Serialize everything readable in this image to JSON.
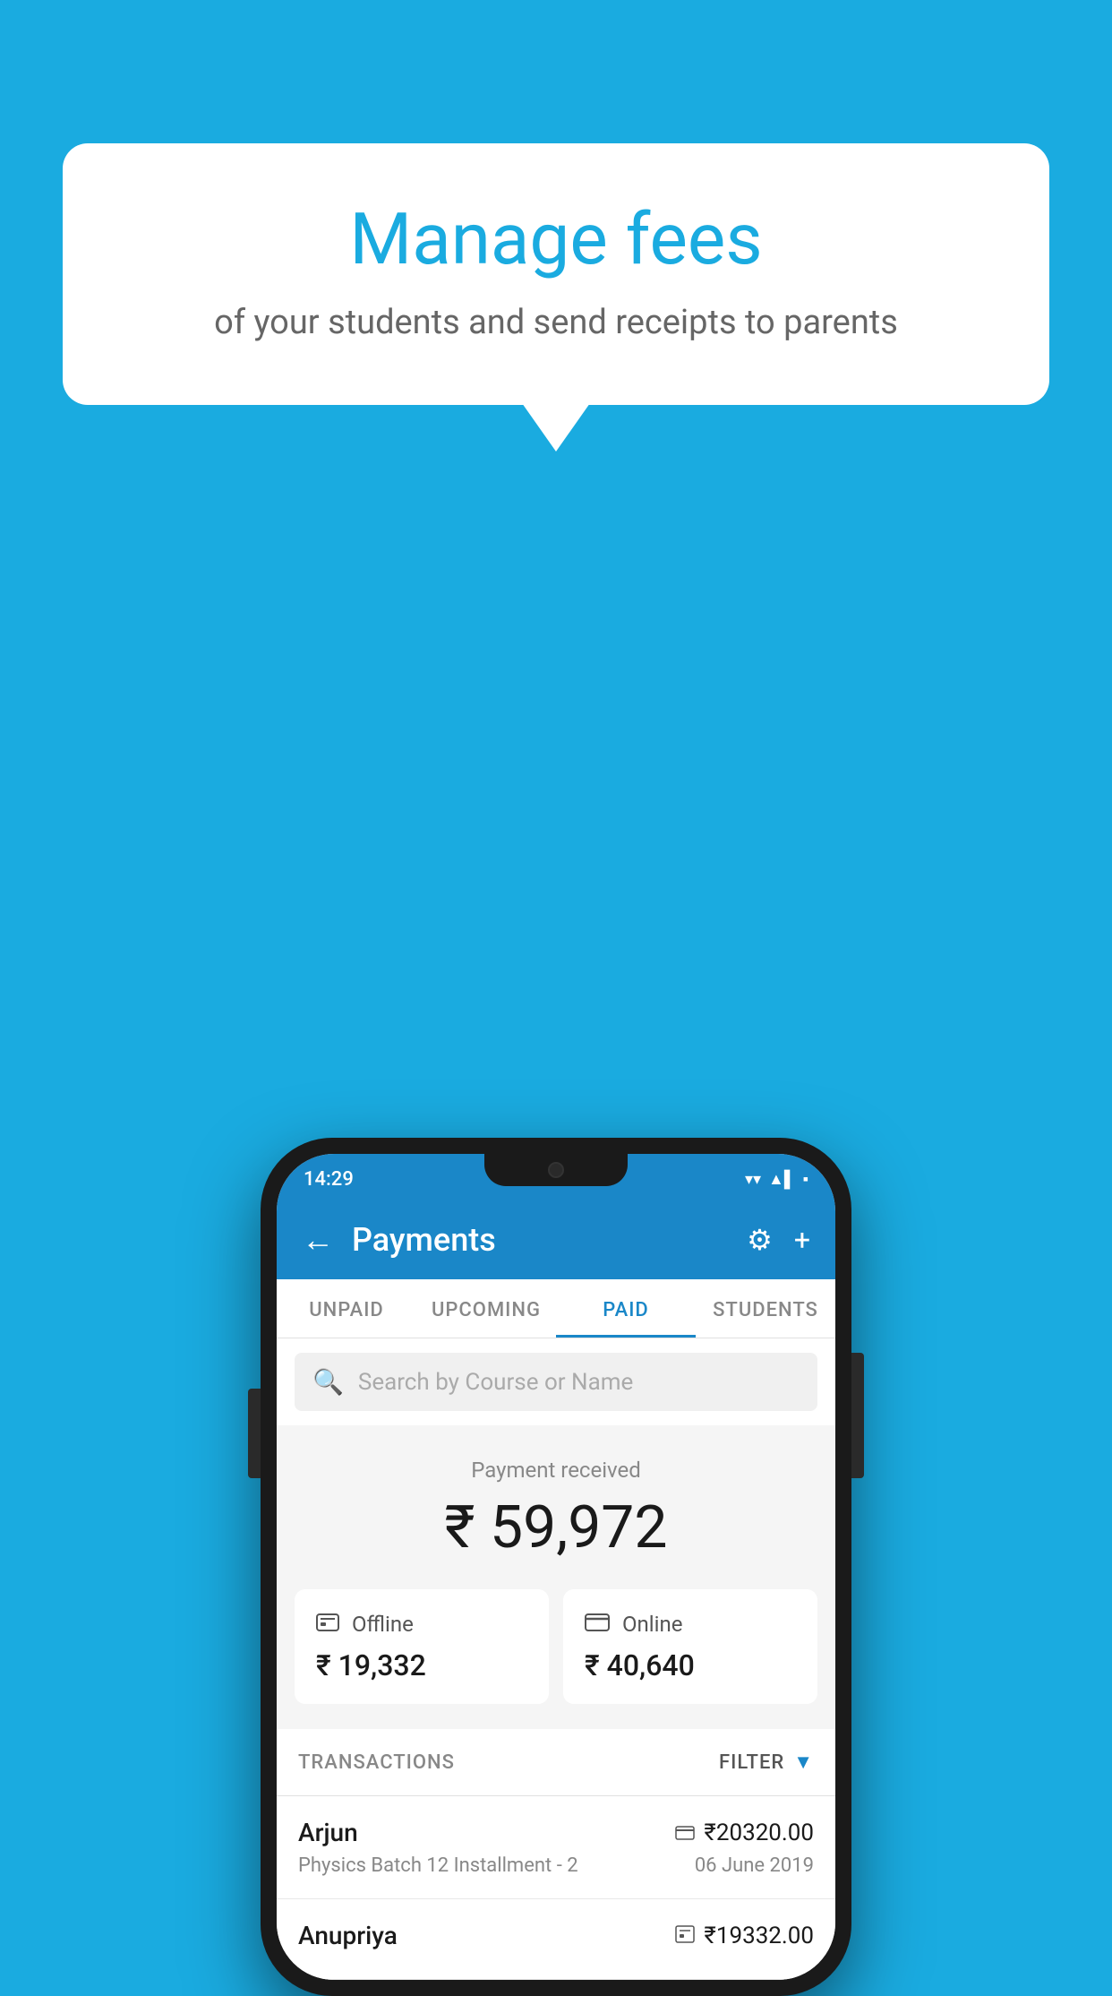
{
  "background_color": "#1AABE0",
  "speech_bubble": {
    "title": "Manage fees",
    "subtitle": "of your students and send receipts to parents"
  },
  "status_bar": {
    "time": "14:29",
    "wifi": "▲",
    "signal": "▲",
    "battery": "▪"
  },
  "app_bar": {
    "title": "Payments",
    "back_icon": "←",
    "settings_icon": "⚙",
    "add_icon": "+"
  },
  "tabs": [
    {
      "label": "UNPAID",
      "active": false
    },
    {
      "label": "UPCOMING",
      "active": false
    },
    {
      "label": "PAID",
      "active": true
    },
    {
      "label": "STUDENTS",
      "active": false
    }
  ],
  "search": {
    "placeholder": "Search by Course or Name"
  },
  "payment_summary": {
    "label": "Payment received",
    "amount": "₹ 59,972",
    "cards": [
      {
        "type": "Offline",
        "amount": "₹ 19,332",
        "icon": "💳"
      },
      {
        "type": "Online",
        "amount": "₹ 40,640",
        "icon": "💳"
      }
    ]
  },
  "transactions": {
    "header": "TRANSACTIONS",
    "filter_label": "FILTER",
    "rows": [
      {
        "name": "Arjun",
        "course": "Physics Batch 12 Installment - 2",
        "amount": "₹20320.00",
        "date": "06 June 2019",
        "payment_type": "online"
      },
      {
        "name": "Anupriya",
        "course": "",
        "amount": "₹19332.00",
        "date": "",
        "payment_type": "offline"
      }
    ]
  }
}
